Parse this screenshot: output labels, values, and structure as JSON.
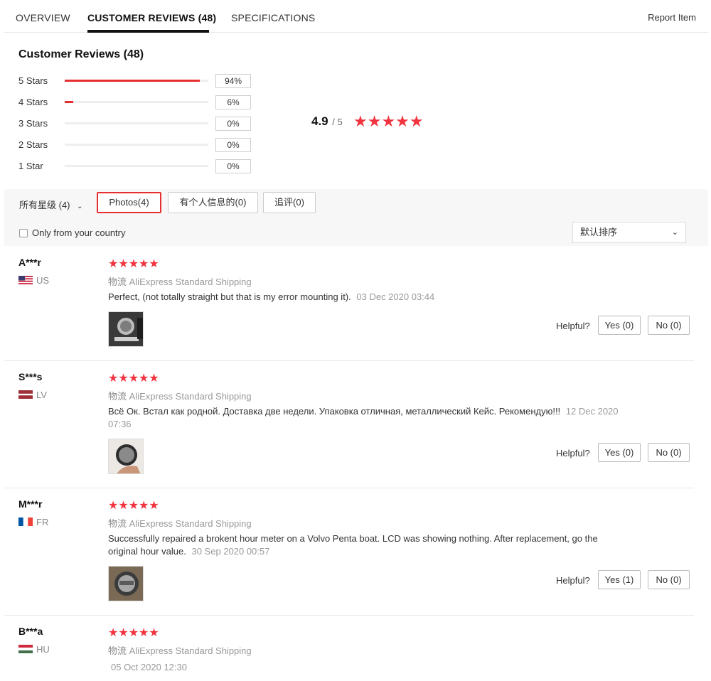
{
  "tabs": [
    {
      "label": "OVERVIEW"
    },
    {
      "label": "CUSTOMER REVIEWS (48)"
    },
    {
      "label": "SPECIFICATIONS"
    }
  ],
  "report_label": "Report Item",
  "summary": {
    "title": "Customer Reviews (48)",
    "distribution": [
      {
        "label": "5 Stars",
        "percent": "94%",
        "fill": 0.94
      },
      {
        "label": "4 Stars",
        "percent": "6%",
        "fill": 0.06
      },
      {
        "label": "3 Stars",
        "percent": "0%",
        "fill": 0
      },
      {
        "label": "2 Stars",
        "percent": "0%",
        "fill": 0
      },
      {
        "label": "1 Star",
        "percent": "0%",
        "fill": 0
      }
    ],
    "average": "4.9",
    "out_of": "/ 5",
    "stars": "★★★★★"
  },
  "filters": {
    "all_label": "所有星级 (4)",
    "photos_label": "Photos(4)",
    "personal_label": "有个人信息的(0)",
    "followup_label": "追评(0)",
    "country_only_label": "Only from your country",
    "sort_label": "默认排序"
  },
  "helpful_label": "Helpful?",
  "reviews": [
    {
      "name": "A***r",
      "country": "US",
      "stars": "★★★★★",
      "ship_key": "物流",
      "ship_value": "AliExpress Standard Shipping",
      "text": "Perfect, (not totally straight but that is my error mounting it).",
      "date": "03 Dec 2020 03:44",
      "yes": "Yes (0)",
      "no": "No (0)"
    },
    {
      "name": "S***s",
      "country": "LV",
      "stars": "★★★★★",
      "ship_key": "物流",
      "ship_value": "AliExpress Standard Shipping",
      "text": "Всё Ок. Встал как родной. Доставка две недели. Упаковка отличная, металлический Кейс. Рекомендую!!!",
      "date": "12 Dec 2020 07:36",
      "yes": "Yes (0)",
      "no": "No (0)"
    },
    {
      "name": "M***r",
      "country": "FR",
      "stars": "★★★★★",
      "ship_key": "物流",
      "ship_value": "AliExpress Standard Shipping",
      "text": "Successfully repaired a brokent hour meter on a Volvo Penta boat. LCD was showing nothing. After replacement, go the original hour value.",
      "date": "30 Sep 2020 00:57",
      "yes": "Yes (1)",
      "no": "No (0)"
    },
    {
      "name": "B***a",
      "country": "HU",
      "stars": "★★★★★",
      "ship_key": "物流",
      "ship_value": "AliExpress Standard Shipping",
      "text": "",
      "date": "05 Oct 2020 12:30"
    }
  ]
}
